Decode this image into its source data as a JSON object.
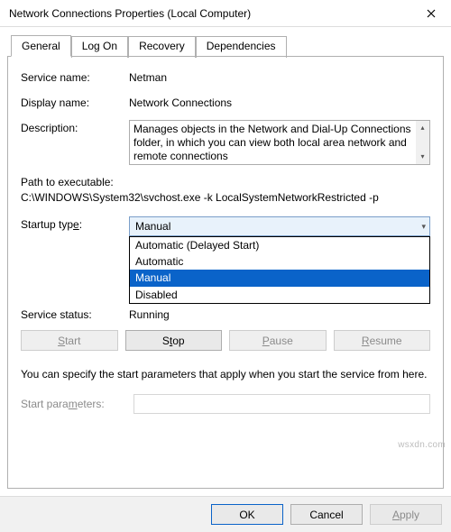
{
  "window": {
    "title": "Network Connections Properties (Local Computer)"
  },
  "tabs": {
    "t0": "General",
    "t1": "Log On",
    "t2": "Recovery",
    "t3": "Dependencies"
  },
  "fields": {
    "service_name_label": "Service name:",
    "service_name_value": "Netman",
    "display_name_label": "Display name:",
    "display_name_value": "Network Connections",
    "description_label": "Description:",
    "description_value": "Manages objects in the Network and Dial-Up Connections folder, in which you can view both local area network and remote connections",
    "path_label": "Path to executable:",
    "path_value": "C:\\WINDOWS\\System32\\svchost.exe -k LocalSystemNetworkRestricted -p",
    "startup_type_label": "Startup type:",
    "startup_type_value": "Manual",
    "startup_options": {
      "o0": "Automatic (Delayed Start)",
      "o1": "Automatic",
      "o2": "Manual",
      "o3": "Disabled"
    },
    "service_status_label": "Service status:",
    "service_status_value": "Running",
    "hint": "You can specify the start parameters that apply when you start the service from here.",
    "start_params_label": "Start parameters:",
    "start_params_value": ""
  },
  "buttons": {
    "start": "Start",
    "stop": "Stop",
    "pause": "Pause",
    "resume": "Resume",
    "ok": "OK",
    "cancel": "Cancel",
    "apply": "Apply"
  },
  "watermark": "wsxdn.com"
}
